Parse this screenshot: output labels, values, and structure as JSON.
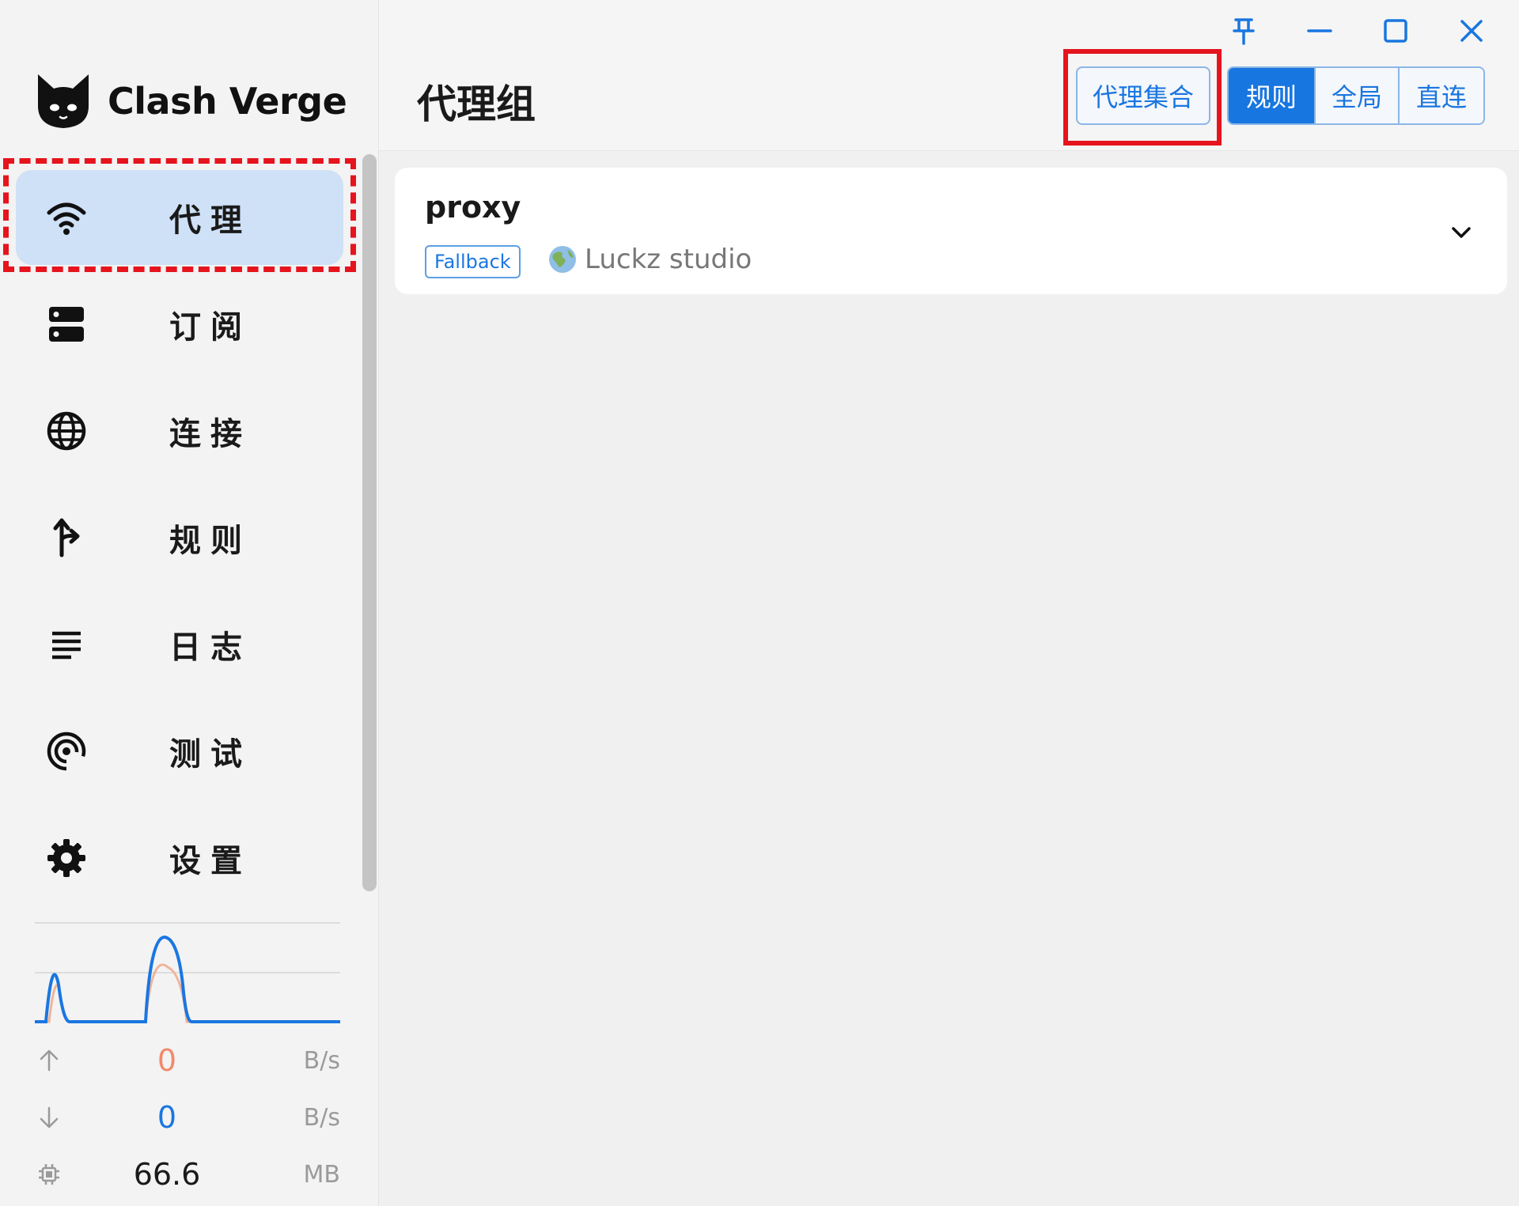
{
  "app": {
    "name": "Clash Verge"
  },
  "window": {
    "controls": [
      "pin-icon",
      "minimize-icon",
      "maximize-icon",
      "close-icon"
    ]
  },
  "sidebar": {
    "items": [
      {
        "label": "代理",
        "icon": "wifi-icon",
        "active": true
      },
      {
        "label": "订阅",
        "icon": "server-icon",
        "active": false
      },
      {
        "label": "连接",
        "icon": "globe-icon",
        "active": false
      },
      {
        "label": "规则",
        "icon": "fork-arrow-icon",
        "active": false
      },
      {
        "label": "日志",
        "icon": "lines-icon",
        "active": false
      },
      {
        "label": "测试",
        "icon": "broadcast-icon",
        "active": false
      },
      {
        "label": "设置",
        "icon": "gear-icon",
        "active": false
      }
    ],
    "traffic": {
      "upload": {
        "value": "0",
        "unit": "B/s",
        "color": "#f08a6b"
      },
      "download": {
        "value": "0",
        "unit": "B/s",
        "color": "#1a76e0"
      },
      "memory": {
        "value": "66.6",
        "unit": "MB"
      }
    }
  },
  "header": {
    "title": "代理组",
    "proxy_set_label": "代理集合",
    "modes": [
      {
        "label": "规则",
        "active": true
      },
      {
        "label": "全局",
        "active": false
      },
      {
        "label": "直连",
        "active": false
      }
    ]
  },
  "proxy_groups": [
    {
      "name": "proxy",
      "type": "Fallback",
      "current": "Luckz studio"
    }
  ],
  "colors": {
    "accent": "#1876e0",
    "active_nav_bg": "#cfe1f6",
    "highlight_red": "#e5141d"
  }
}
